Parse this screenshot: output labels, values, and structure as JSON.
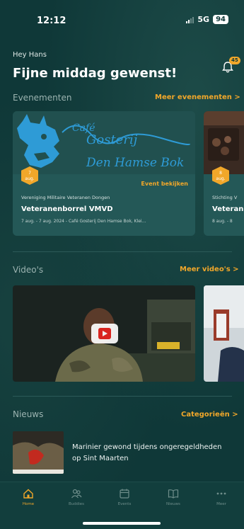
{
  "status_bar": {
    "time": "12:12",
    "network": "5G",
    "battery": "94"
  },
  "header": {
    "greeting": "Hey Hans",
    "headline": "Fijne middag gewenst!",
    "notification_count": "45"
  },
  "events": {
    "section_title": "Evenementen",
    "more_link": "Meer evenementen >",
    "items": [
      {
        "badge_day": "7",
        "badge_month": "aug.",
        "cta": "Event bekijken",
        "organizer": "Vereniging Militaire Veteranen Dongen",
        "title": "Veteranenborrel VMVD",
        "meta": "7 aug. - 7 aug. 2024 - Café Gosterij Den Hamse Bok, Klei...",
        "image_text_1": "Café",
        "image_text_2": "Gosterij",
        "image_text_3": "Den Hamse Bok"
      },
      {
        "badge_day": "8",
        "badge_month": "aug.",
        "organizer": "Stichting V",
        "title": "Veteran",
        "meta": "8 aug. - 8"
      }
    ]
  },
  "videos": {
    "section_title": "Video's",
    "more_link": "Meer video's >"
  },
  "news": {
    "section_title": "Nieuws",
    "more_link": "Categorieën >",
    "items": [
      {
        "title": "Marinier gewond tijdens ongeregeldheden op Sint Maarten"
      }
    ]
  },
  "tabbar": {
    "items": [
      {
        "label": "Home",
        "icon": "home-icon"
      },
      {
        "label": "Buddies",
        "icon": "people-icon"
      },
      {
        "label": "Events",
        "icon": "calendar-icon"
      },
      {
        "label": "Nieuws",
        "icon": "book-icon"
      },
      {
        "label": "Meer",
        "icon": "more-icon"
      }
    ]
  },
  "colors": {
    "background": "#0f3838",
    "card": "#245857",
    "accent": "#f1a72a"
  }
}
